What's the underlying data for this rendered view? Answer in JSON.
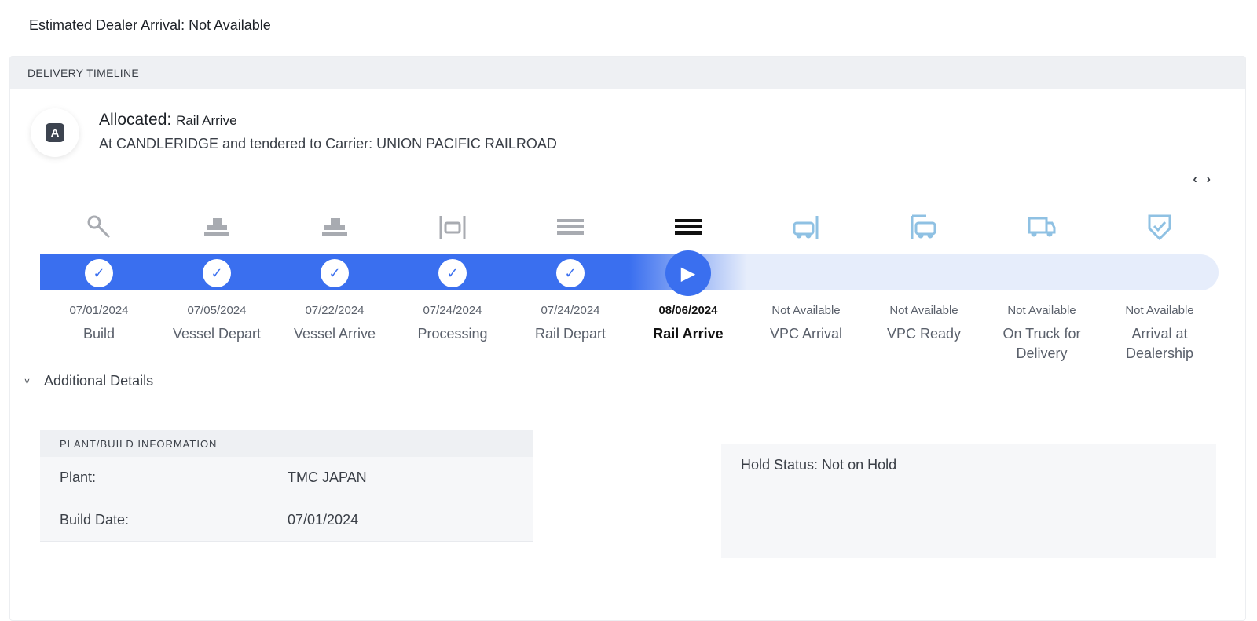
{
  "eta_text": "Estimated Dealer Arrival: Not Available",
  "timeline_header": "DELIVERY TIMELINE",
  "allocation": {
    "badge_letter": "A",
    "title_prefix": "Allocated:",
    "status": "Rail Arrive",
    "subtitle": "At CANDLERIDGE and tendered to Carrier: UNION PACIFIC RAILROAD"
  },
  "nav": {
    "prev": "‹",
    "next": "›"
  },
  "steps": [
    {
      "date": "07/01/2024",
      "label": "Build",
      "state": "done",
      "icon": "wrench-icon"
    },
    {
      "date": "07/05/2024",
      "label": "Vessel Depart",
      "state": "done",
      "icon": "ship-icon"
    },
    {
      "date": "07/22/2024",
      "label": "Vessel Arrive",
      "state": "done",
      "icon": "ship-icon"
    },
    {
      "date": "07/24/2024",
      "label": "Processing",
      "state": "done",
      "icon": "processing-icon"
    },
    {
      "date": "07/24/2024",
      "label": "Rail Depart",
      "state": "done",
      "icon": "train-icon"
    },
    {
      "date": "08/06/2024",
      "label": "Rail Arrive",
      "state": "current",
      "icon": "train-icon"
    },
    {
      "date": "Not Available",
      "label": "VPC Arrival",
      "state": "pending",
      "icon": "vpc-arrival-icon"
    },
    {
      "date": "Not Available",
      "label": "VPC Ready",
      "state": "pending",
      "icon": "vpc-ready-icon"
    },
    {
      "date": "Not Available",
      "label": "On Truck for Delivery",
      "state": "pending",
      "icon": "truck-icon"
    },
    {
      "date": "Not Available",
      "label": "Arrival at Dealership",
      "state": "pending",
      "icon": "shield-check-icon"
    }
  ],
  "additional_details": {
    "toggle_label": "Additional Details",
    "plant_header": "PLANT/BUILD INFORMATION",
    "plant_label": "Plant:",
    "plant_value": "TMC JAPAN",
    "build_date_label": "Build Date:",
    "build_date_value": "07/01/2024",
    "hold_status": "Hold Status: Not on Hold"
  },
  "colors": {
    "accent": "#3a6fef",
    "track_pending": "#e6edfb",
    "icon_done": "#a8abb1",
    "icon_pending": "#8fc1e3",
    "icon_current": "#111111"
  }
}
